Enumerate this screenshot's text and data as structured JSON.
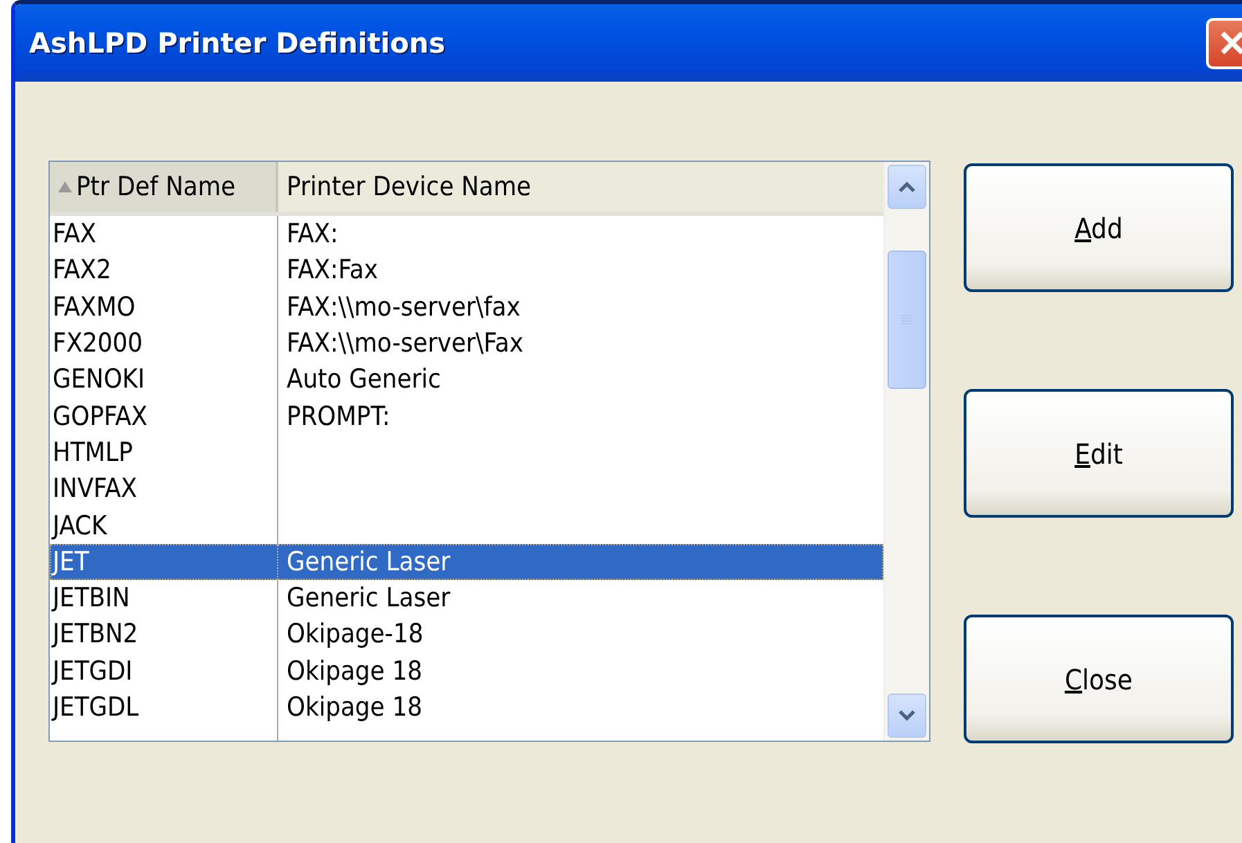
{
  "window": {
    "title": "AshLPD Printer Definitions"
  },
  "table": {
    "columns": [
      {
        "label": "Ptr Def Name",
        "sorted": true
      },
      {
        "label": "Printer Device Name",
        "sorted": false
      }
    ],
    "rows": [
      {
        "name": "FAX",
        "device": "FAX:",
        "selected": false
      },
      {
        "name": "FAX2",
        "device": "FAX:Fax",
        "selected": false
      },
      {
        "name": "FAXMO",
        "device": "FAX:\\\\mo-server\\fax",
        "selected": false
      },
      {
        "name": "FX2000",
        "device": "FAX:\\\\mo-server\\Fax",
        "selected": false
      },
      {
        "name": "GENOKI",
        "device": "Auto Generic",
        "selected": false
      },
      {
        "name": "GOPFAX",
        "device": "PROMPT:",
        "selected": false
      },
      {
        "name": "HTMLP",
        "selected": false
      },
      {
        "name": "INVFAX",
        "selected": false
      },
      {
        "name": "JACK",
        "selected": false
      },
      {
        "name": "JET",
        "device": "Generic Laser",
        "selected": true
      },
      {
        "name": "JETBIN",
        "device": "Generic Laser",
        "selected": false
      },
      {
        "name": "JETBN2",
        "device": "Okipage-18",
        "selected": false
      },
      {
        "name": "JETGDI",
        "device": "Okipage 18",
        "selected": false
      },
      {
        "name": "JETGDL",
        "device": "Okipage 18",
        "selected": false
      }
    ]
  },
  "buttons": [
    {
      "mnemonic": "A",
      "rest": "dd"
    },
    {
      "mnemonic": "E",
      "rest": "dit"
    },
    {
      "mnemonic": "C",
      "rest": "lose"
    }
  ]
}
